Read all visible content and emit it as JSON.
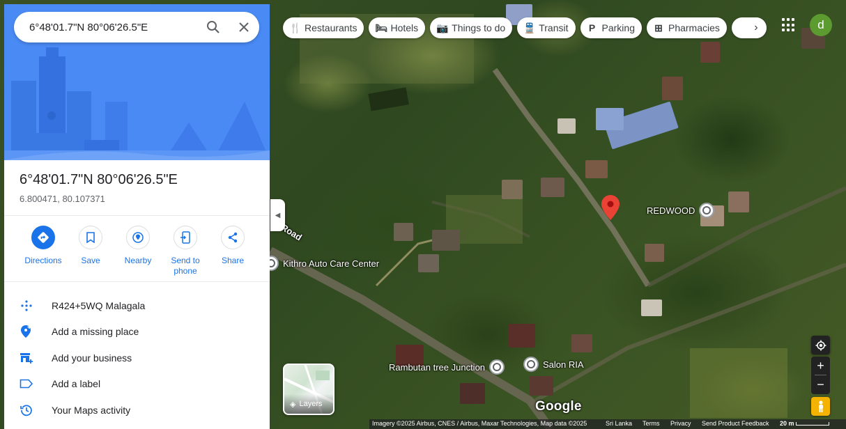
{
  "search": {
    "query": "6°48'01.7\"N 80°06'26.5\"E"
  },
  "place": {
    "title": "6°48'01.7\"N 80°06'26.5\"E",
    "coordinates": "6.800471, 80.107371"
  },
  "actions": [
    {
      "label": "Directions",
      "icon": "directions-icon"
    },
    {
      "label": "Save",
      "icon": "bookmark-icon"
    },
    {
      "label": "Nearby",
      "icon": "nearby-icon"
    },
    {
      "label": "Send to phone",
      "icon": "send-to-phone-icon"
    },
    {
      "label": "Share",
      "icon": "share-icon"
    }
  ],
  "info_list": [
    {
      "text": "R424+5WQ Malagala",
      "icon": "plus-code-icon"
    },
    {
      "text": "Add a missing place",
      "icon": "add-place-icon"
    },
    {
      "text": "Add your business",
      "icon": "add-business-icon"
    },
    {
      "text": "Add a label",
      "icon": "label-icon"
    },
    {
      "text": "Your Maps activity",
      "icon": "history-icon"
    }
  ],
  "chips": [
    {
      "label": "Restaurants",
      "icon": "restaurant-icon"
    },
    {
      "label": "Hotels",
      "icon": "hotel-icon"
    },
    {
      "label": "Things to do",
      "icon": "camera-icon"
    },
    {
      "label": "Transit",
      "icon": "transit-icon"
    },
    {
      "label": "Parking",
      "icon": "parking-icon"
    },
    {
      "label": "Pharmacies",
      "icon": "pharmacy-icon"
    }
  ],
  "account": {
    "initial": "d"
  },
  "map": {
    "road_label": "Road",
    "pois": {
      "kithro": "Kithro Auto Care Center",
      "redwood": "REDWOOD",
      "rambutan": "Rambutan tree Junction",
      "salon": "Salon RIA"
    },
    "layers_label": "Layers",
    "logo": "Google"
  },
  "footer": {
    "imagery": "Imagery ©2025 Airbus, CNES / Airbus, Maxar Technologies, Map data ©2025",
    "country": "Sri Lanka",
    "terms": "Terms",
    "privacy": "Privacy",
    "feedback": "Send Product Feedback",
    "scale": "20 m"
  },
  "colors": {
    "accent": "#1a73e8",
    "hero_bg": "#4a8af4",
    "pin": "#ea4335",
    "avatar": "#5b9b2f"
  }
}
